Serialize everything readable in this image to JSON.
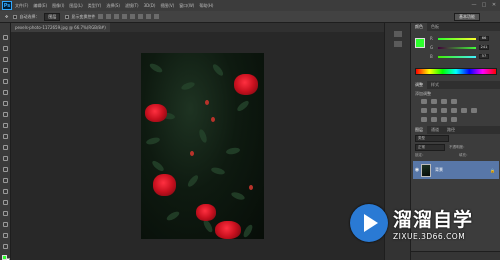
{
  "app": {
    "logo": "Ps",
    "menu": [
      "文件(F)",
      "编辑(E)",
      "图像(I)",
      "图层(L)",
      "类型(Y)",
      "选择(S)",
      "滤镜(T)",
      "3D(D)",
      "视图(V)",
      "窗口(W)",
      "帮助(H)"
    ],
    "window_controls": [
      "—",
      "□",
      "✕"
    ]
  },
  "options": {
    "auto_select_label": "自动选择：",
    "auto_select_value": "图层",
    "show_transform_label": "显示变换控件",
    "workspace": "基本功能"
  },
  "document": {
    "tab_title": "pexels-photo-1172659.jpg @ 66.7%(RGB/8#)"
  },
  "color_panel": {
    "tabs": [
      "颜色",
      "色板"
    ],
    "sliders": [
      {
        "label": "R",
        "value": "66",
        "color": "#ff4646"
      },
      {
        "label": "G",
        "value": "241",
        "color": "#46ff46"
      },
      {
        "label": "B",
        "value": "57",
        "color": "#4646ff"
      }
    ],
    "foreground_color": "#2cff2c"
  },
  "adjustments_panel": {
    "tabs": [
      "调整",
      "样式"
    ],
    "title": "添加调整"
  },
  "layers_panel": {
    "tabs": [
      "图层",
      "通道",
      "路径"
    ],
    "kind_filter": "类型",
    "blend_mode": "正常",
    "opacity_label": "不透明度：",
    "lock_label": "锁定：",
    "fill_label": "填充：",
    "layer": {
      "name": "背景",
      "visible": true
    }
  },
  "watermark": {
    "text": "溜溜自学",
    "url": "ZIXUE.3D66.COM"
  }
}
